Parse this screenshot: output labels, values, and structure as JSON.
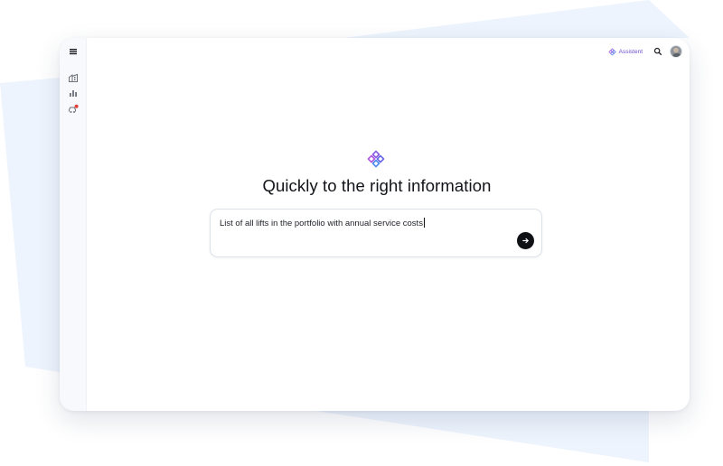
{
  "topbar": {
    "assistant_label": "Assistent"
  },
  "sidebar": {
    "items": [
      {
        "icon": "building-icon"
      },
      {
        "icon": "bar-chart-icon"
      },
      {
        "icon": "alert-car-icon"
      }
    ]
  },
  "main": {
    "headline": "Quickly to the right information",
    "prompt_value": "List of all lifts in the portfolio with annual service costs"
  },
  "colors": {
    "accent": "#6b4ecf",
    "send_button": "#0f1115",
    "backdrop": "#eaf2fc"
  }
}
